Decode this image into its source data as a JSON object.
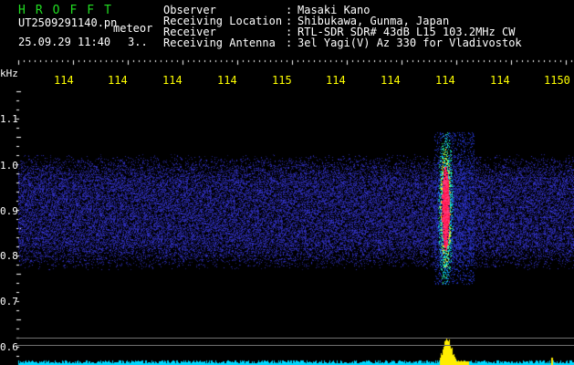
{
  "header": {
    "logo": "HROFFT",
    "filename": "UT2509291140.pn",
    "event_type": "meteor",
    "datetime": "25.09.29 11:40",
    "count": "3..",
    "fields": [
      {
        "label": "Observer",
        "value": "Masaki Kano"
      },
      {
        "label": "Receiving Location",
        "value": "Shibukawa, Gunma, Japan"
      },
      {
        "label": "Receiver",
        "value": "RTL-SDR SDR# 43dB L15 103.2MHz CW"
      },
      {
        "label": "Receiving Antenna",
        "value": "3el Yagi(V) Az 330 for Vladivostok"
      }
    ]
  },
  "axes": {
    "y_unit": "kHz",
    "x_ticks": [
      "114",
      "114",
      "114",
      "114",
      "115",
      "114",
      "114",
      "114",
      "114",
      "1150"
    ],
    "y_ticks": [
      "1.1",
      "1.0",
      "0.9",
      "0.8",
      "0.7",
      "0.6"
    ]
  },
  "colors": {
    "background": "#000000",
    "noise": "#1a1aa0",
    "signal_hot": "#ff2060",
    "signal_warm": "#00d0ff",
    "ticks_x": "#ffff00",
    "trace": "#00d8ff",
    "logo": "#22dd22"
  }
}
